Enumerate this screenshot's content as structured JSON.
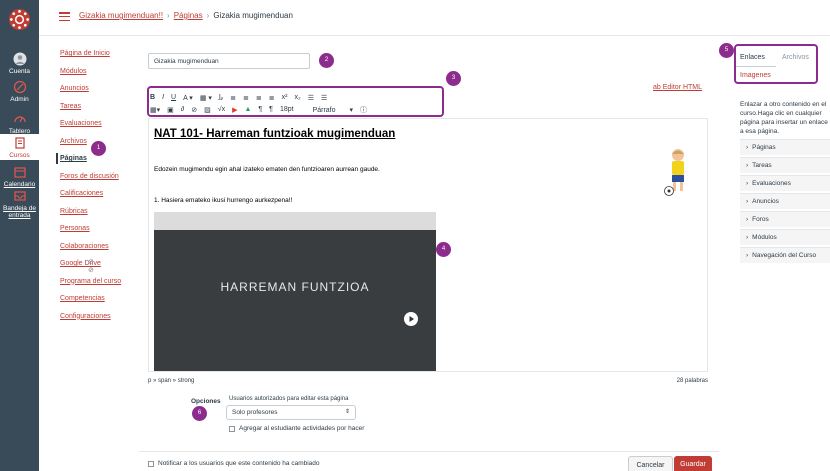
{
  "global_nav": [
    {
      "label": "Cuenta"
    },
    {
      "label": "Admin"
    },
    {
      "label": "Tablero"
    },
    {
      "label": "Cursos"
    },
    {
      "label": "Calendario"
    },
    {
      "label": "Bandeja de entrada"
    }
  ],
  "breadcrumb": {
    "course": "Gizakia mugimenduan!!",
    "section": "Páginas",
    "current": "Gizakia mugimenduan"
  },
  "course_nav": [
    {
      "label": "Página de Inicio"
    },
    {
      "label": "Módulos"
    },
    {
      "label": "Anuncios"
    },
    {
      "label": "Tareas"
    },
    {
      "label": "Evaluaciones"
    },
    {
      "label": "Archivos"
    },
    {
      "label": "Páginas"
    },
    {
      "label": "Foros de discusión"
    },
    {
      "label": "Calificaciones"
    },
    {
      "label": "Rúbricas"
    },
    {
      "label": "Personas"
    },
    {
      "label": "Colaboraciones"
    },
    {
      "label": "Google Drive"
    },
    {
      "label": "Programa del curso"
    },
    {
      "label": "Competencias"
    },
    {
      "label": "Configuraciones"
    }
  ],
  "editor": {
    "title_value": "Gizakia mugimenduan",
    "html_editor_link": "Editor HTML",
    "toolbar": {
      "font_size": "18pt",
      "block_format": "Párrafo"
    },
    "content": {
      "heading": "NAT 101- Harreman funtzioak mugimenduan",
      "paragraph1": "Edozein mugimendu egin ahal izateko ematen den funtzioaren aurrean gaude.",
      "paragraph2": "1. Hasiera emateko ikusi hurrengo aurkezpena!!",
      "video_title": "HARREMAN FUNTZIOA"
    },
    "status_path": "p » span » strong",
    "word_count": "28 palabras"
  },
  "options": {
    "label": "Opciones",
    "permission_label": "Usuarios autorizados para editar esta página",
    "permission_value": "Solo profesores",
    "add_to_todo": "Agregar al estudiante actividades por hacer"
  },
  "footer": {
    "notify": "Notificar a los usuarios que este contenido ha cambiado",
    "cancel": "Cancelar",
    "save": "Guardar"
  },
  "sidebar": {
    "tabs": {
      "links": "Enlaces",
      "files": "Archivos",
      "images": "Imagenes"
    },
    "description": "Enlazar a otro contenido en el curso.Haga clic en cualquier página para insertar un enlace a esa página.",
    "sections": [
      {
        "label": "Páginas"
      },
      {
        "label": "Tareas"
      },
      {
        "label": "Evaluaciones"
      },
      {
        "label": "Anuncios"
      },
      {
        "label": "Foros"
      },
      {
        "label": "Módulos"
      },
      {
        "label": "Navegación del Curso"
      }
    ]
  },
  "badges": [
    "1",
    "2",
    "3",
    "4",
    "5",
    "6"
  ],
  "colors": {
    "accent": "#c03c34",
    "badge": "#8c2c8c",
    "nav_bg": "#394b58"
  }
}
